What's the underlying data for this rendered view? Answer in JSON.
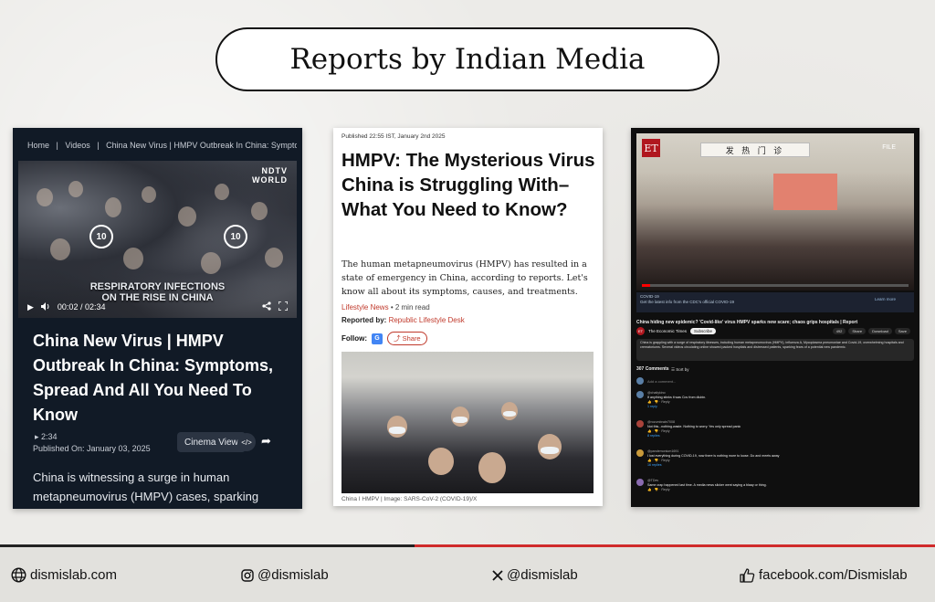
{
  "page": {
    "title": "Reports by Indian Media"
  },
  "panel1": {
    "breadcrumb": [
      "Home",
      "|",
      "Videos",
      "|",
      "China New Virus | HMPV Outbreak In China: Symptoms,"
    ],
    "video": {
      "brand_top": "NDTV",
      "brand_bottom": "WORLD",
      "replay_back": "10",
      "replay_fwd": "10",
      "caption_line1": "RESPIRATORY INFECTIONS",
      "caption_line2": "ON THE RISE IN CHINA",
      "time": "00:02 / 02:34"
    },
    "headline": "China New Virus | HMPV Outbreak In China: Symptoms, Spread And All You Need To Know",
    "duration": "2:34",
    "published": "Published On: January 03, 2025",
    "cinema_label": "Cinema View",
    "body": "China is witnessing a surge in human metapneumovirus (HMPV) cases, sparking concerns of a pandemic akin to COVID-",
    "icons": [
      "play-icon",
      "volume-icon",
      "share-icon",
      "fullscreen-icon",
      "embed-icon"
    ]
  },
  "panel2": {
    "date": "Published 22:55 IST, January 2nd 2025",
    "headline": "HMPV: The Mysterious Virus China is Struggling With– What You Need to Know?",
    "dek": "The human metapneumovirus (HMPV) has resulted in a state of emergency in China, according to reports. Let's know all about its symptoms, causes, and treatments.",
    "category": "Lifestyle News",
    "read_time": "2 min read",
    "byline_label": "Reported by:",
    "byline_desk": "Republic Lifestyle Desk",
    "follow_label": "Follow:",
    "share_label": "Share",
    "credit": "China I HMPV | Image: SARS-CoV-2 (COVID-19)/X"
  },
  "panel3": {
    "et_logo": "ET",
    "file_tag": "FILE",
    "sign_text": "发 热 门 诊",
    "video_time": "0:01 / 3:57",
    "notice_title": "COVID-19",
    "notice_text": "Get the latest info from the CDC's official COVID-19",
    "notice_link": "Learn more",
    "title": "China hiding new epidemic? 'Covid-like' virus HMPV sparks new scare; chaos grips hospitals | Report",
    "channel_name": "The Economic Times",
    "subscribe_label": "Subscribe",
    "actions": [
      "492",
      "Share",
      "Download",
      "Save"
    ],
    "description": "China is grappling with a surge of respiratory illnesses, including human metapneumovirus (HMPV), influenza A, Mycoplasma pneumoniae and Covid-19, overwhelming hospitals and crematoriums. Several videos circulating online showed packed hospitals and distressed patients, sparking fears of a potential new pandemic.",
    "comment_count": "307 Comments",
    "sort_label": "Sort by",
    "add_comment": "Add a comment...",
    "comments": [
      {
        "author": "@chaitykino",
        "text": "If anything stinks it was Cov from dlubin.",
        "replies": "1 reply"
      },
      {
        "author": "@rozumbrabr7008",
        "text": "Not this...nothing.waste. Nothing to worry. Yes only spread panic",
        "replies": "8 replies"
      },
      {
        "author": "@pandemonium1691",
        "text": "I lost everything during COVID-19, now there is nothing more to loose. Do and meets away",
        "replies": "16 replies"
      },
      {
        "author": "@TDev",
        "text": "Same crap happened last time. A media news slicker went saying a blaay or thing.",
        "replies": ""
      }
    ]
  },
  "footer": {
    "website": "dismislab.com",
    "instagram": "@dismislab",
    "x": "@dismislab",
    "facebook": "facebook.com/Dismislab"
  },
  "colors": {
    "accent_red": "#d02b2b",
    "ndtv_bg": "#111a26",
    "republic_red": "#c0392b",
    "et_red": "#b0171f"
  }
}
